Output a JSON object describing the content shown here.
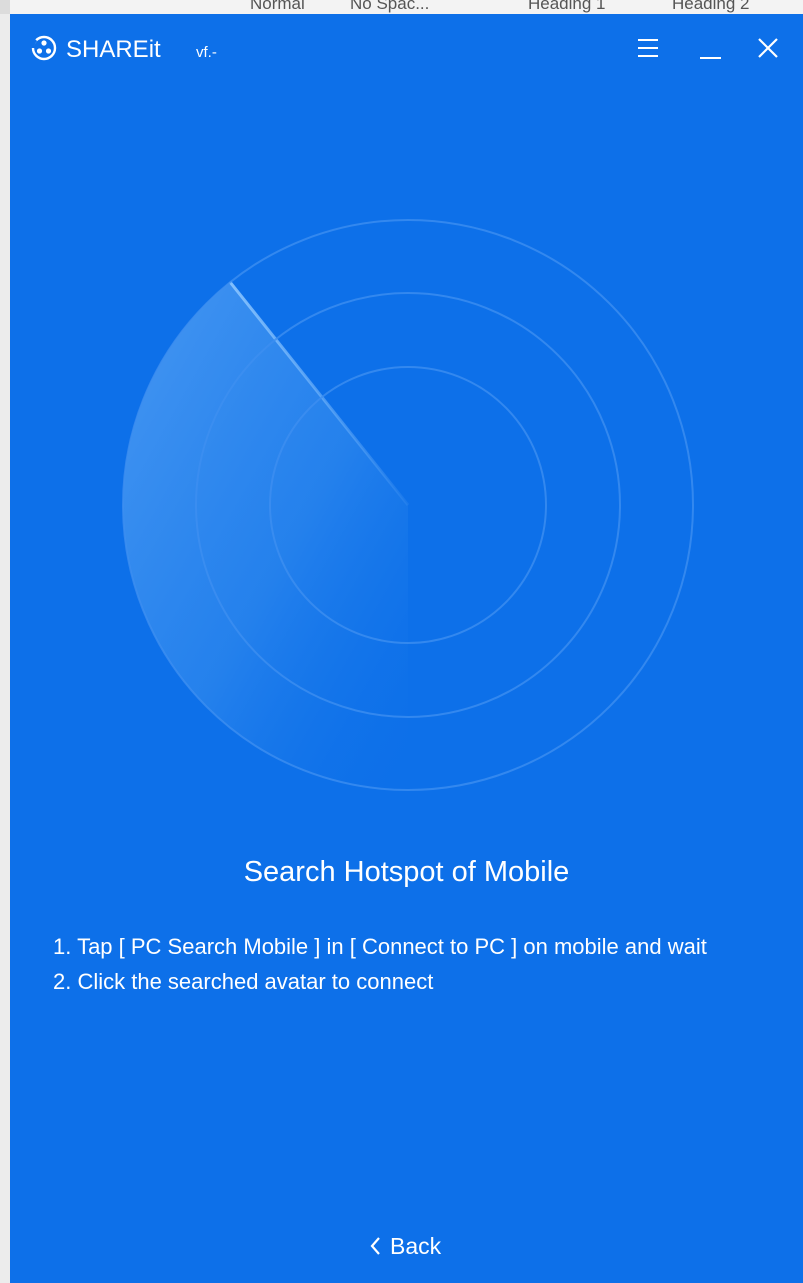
{
  "background_app": {
    "ribbon_fragments": [
      "Normal",
      "No Spac...",
      "Heading 1",
      "Heading 2"
    ]
  },
  "window": {
    "app_name": "SHAREit",
    "version": "vf.-",
    "menu_icon": "hamburger-menu-icon",
    "minimize_icon": "minimize-icon",
    "close_icon": "close-icon"
  },
  "main": {
    "heading": "Search Hotspot of Mobile",
    "instructions": [
      "1. Tap [ PC Search Mobile ] in [ Connect to PC ] on mobile and wait",
      "2. Click the searched avatar to connect"
    ],
    "radar_icon": "radar-scan-icon"
  },
  "footer": {
    "back_label": "Back",
    "back_icon": "chevron-left-icon"
  },
  "colors": {
    "background": "#0d70e9",
    "text": "#ffffff",
    "radar_ring": "#3d8ef0",
    "sweep": "#5aa7f5"
  }
}
